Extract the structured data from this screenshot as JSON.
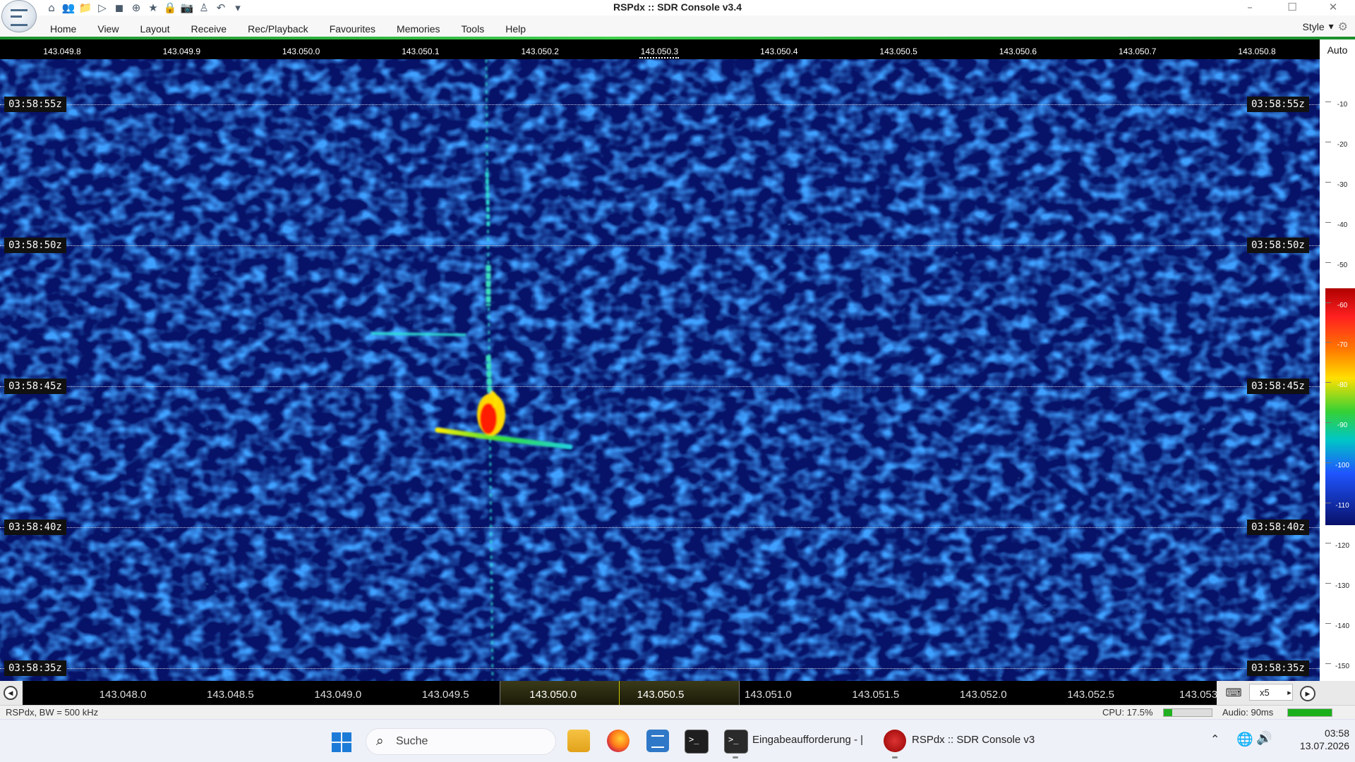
{
  "window": {
    "title": "RSPdx :: SDR Console v3.4",
    "minimize": "–",
    "maximize": "☐",
    "close": "✕"
  },
  "quick_access": [
    {
      "icon": "home-icon",
      "glyph": "⌂"
    },
    {
      "icon": "users-icon",
      "glyph": "👥"
    },
    {
      "icon": "folder-icon",
      "glyph": "📁"
    },
    {
      "icon": "play-icon",
      "glyph": "▷"
    },
    {
      "icon": "stop-icon",
      "glyph": "◼"
    },
    {
      "icon": "add-icon",
      "glyph": "⊕"
    },
    {
      "icon": "star-icon",
      "glyph": "★"
    },
    {
      "icon": "lock-icon",
      "glyph": "🔒"
    },
    {
      "icon": "camera-icon",
      "glyph": "📷"
    },
    {
      "icon": "signal-icon",
      "glyph": "♙"
    },
    {
      "icon": "undo-icon",
      "glyph": "↶"
    },
    {
      "icon": "customize-icon",
      "glyph": "▾"
    }
  ],
  "menu": [
    "Home",
    "View",
    "Layout",
    "Receive",
    "Rec/Playback",
    "Favourites",
    "Memories",
    "Tools",
    "Help"
  ],
  "style_menu": {
    "label": "Style",
    "arrow": "▾",
    "icon": "gear-icon",
    "glyph": "⚙"
  },
  "top_ruler": {
    "ticks": [
      "143.049.8",
      "143.049.9",
      "143.050.0",
      "143.050.1",
      "143.050.2",
      "143.050.3",
      "143.050.4",
      "143.050.5",
      "143.050.6",
      "143.050.7",
      "143.050.8"
    ]
  },
  "auto_button": "Auto",
  "waterfall": {
    "time_labels": [
      "03:58:55z",
      "03:58:50z",
      "03:58:45z",
      "03:58:40z",
      "03:58:35z"
    ]
  },
  "db_scale": {
    "labels": [
      "-10",
      "-20",
      "-30",
      "-40",
      "-50",
      "-60",
      "-70",
      "-80",
      "-90",
      "-100",
      "-110",
      "-120",
      "-130",
      "-140",
      "-150"
    ]
  },
  "bottom_ruler": {
    "ticks": [
      "143.048.0",
      "143.048.5",
      "143.049.0",
      "143.049.5",
      "143.050.0",
      "143.050.5",
      "143.051.0",
      "143.051.5",
      "143.052.0",
      "143.052.5",
      "143.053"
    ],
    "zoom": "x5",
    "zoom_arrow": "▸",
    "keyboard_glyph": "⌨",
    "rewind_glyph": "◀",
    "forward_glyph": "▶"
  },
  "status": {
    "left": "RSPdx, BW = 500 kHz",
    "cpu": "CPU: 17.5%",
    "cpu_level": 0.175,
    "audio": "Audio: 90ms",
    "audio_level": 1.0
  },
  "taskbar": {
    "search_placeholder": "Suche",
    "search_glyph": "⌕",
    "cmd_label": "Eingabeaufforderung - |",
    "sdr_label": "RSPdx :: SDR Console v3",
    "terminal_prompt": ">_",
    "tray_chevron": "⌃",
    "tray_network": "🌐",
    "tray_volume": "🔊",
    "time": "03:58",
    "date": "13.07.2026"
  },
  "colors": {
    "waterfall_background": "#03072b",
    "signal_cyan": "#2fe3d8",
    "signal_hot": "#ff1a00",
    "ribbon_accent": "#3fd04d"
  }
}
